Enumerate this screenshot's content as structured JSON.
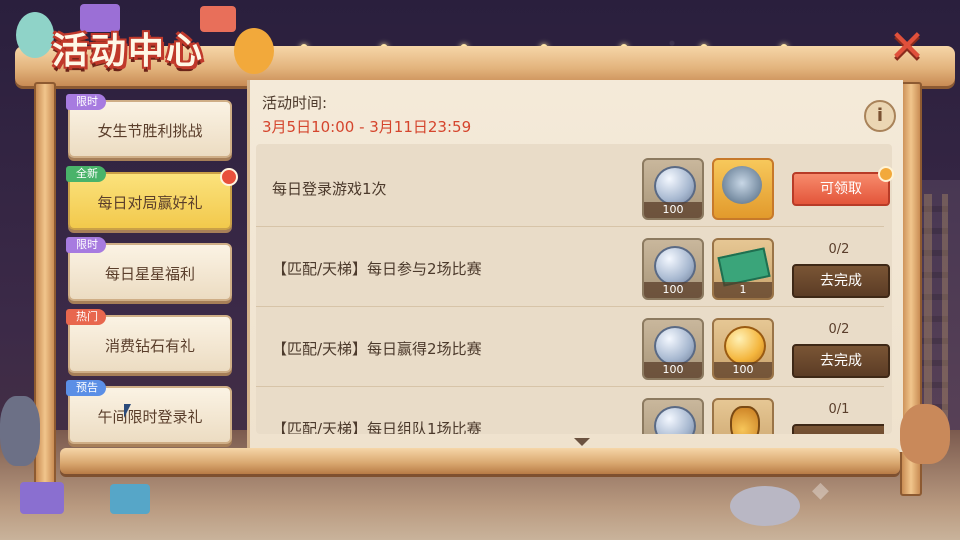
{
  "header": {
    "title": "活动中心",
    "close_label": "✕"
  },
  "info_icon": "info-icon",
  "activity_time": {
    "label": "活动时间:",
    "range": "3月5日10:00 - 3月11日23:59"
  },
  "sidebar": {
    "items": [
      {
        "tag": "限时",
        "tag_color": "#a77be0",
        "label": "女生节胜利挑战",
        "active": false
      },
      {
        "tag": "全新",
        "tag_color": "#49b36a",
        "label": "每日对局赢好礼",
        "active": true
      },
      {
        "tag": "限时",
        "tag_color": "#a77be0",
        "label": "每日星星福利",
        "active": false
      },
      {
        "tag": "热门",
        "tag_color": "#e8674e",
        "label": "消费钻石有礼",
        "active": false
      },
      {
        "tag": "预告",
        "tag_color": "#5b8fe6",
        "label": "午间限时登录礼",
        "active": false
      }
    ]
  },
  "tasks": [
    {
      "title": "每日登录游戏1次",
      "rewards": [
        {
          "icon": "silver-coin-icon",
          "count": "100"
        },
        {
          "icon": "character-portrait-icon",
          "count": ""
        }
      ],
      "progress": "",
      "button": "可领取",
      "button_type": "claim"
    },
    {
      "title": "【匹配/天梯】每日参与2场比赛",
      "rewards": [
        {
          "icon": "silver-coin-icon",
          "count": "100"
        },
        {
          "icon": "ticket-icon",
          "count": "1"
        }
      ],
      "progress": "0/2",
      "button": "去完成",
      "button_type": "go"
    },
    {
      "title": "【匹配/天梯】每日赢得2场比赛",
      "rewards": [
        {
          "icon": "silver-coin-icon",
          "count": "100"
        },
        {
          "icon": "gold-coin-icon",
          "count": "100"
        }
      ],
      "progress": "0/2",
      "button": "去完成",
      "button_type": "go"
    },
    {
      "title": "【匹配/天梯】每日组队1场比赛",
      "rewards": [
        {
          "icon": "silver-coin-icon",
          "count": ""
        },
        {
          "icon": "potion-icon",
          "count": ""
        }
      ],
      "progress": "0/1",
      "button": "",
      "button_type": "go"
    }
  ],
  "colors": {
    "accent_red": "#d5452d",
    "active_tab": "#f2c94c",
    "claim_button": "#e3553a",
    "go_button": "#5b3c25"
  }
}
